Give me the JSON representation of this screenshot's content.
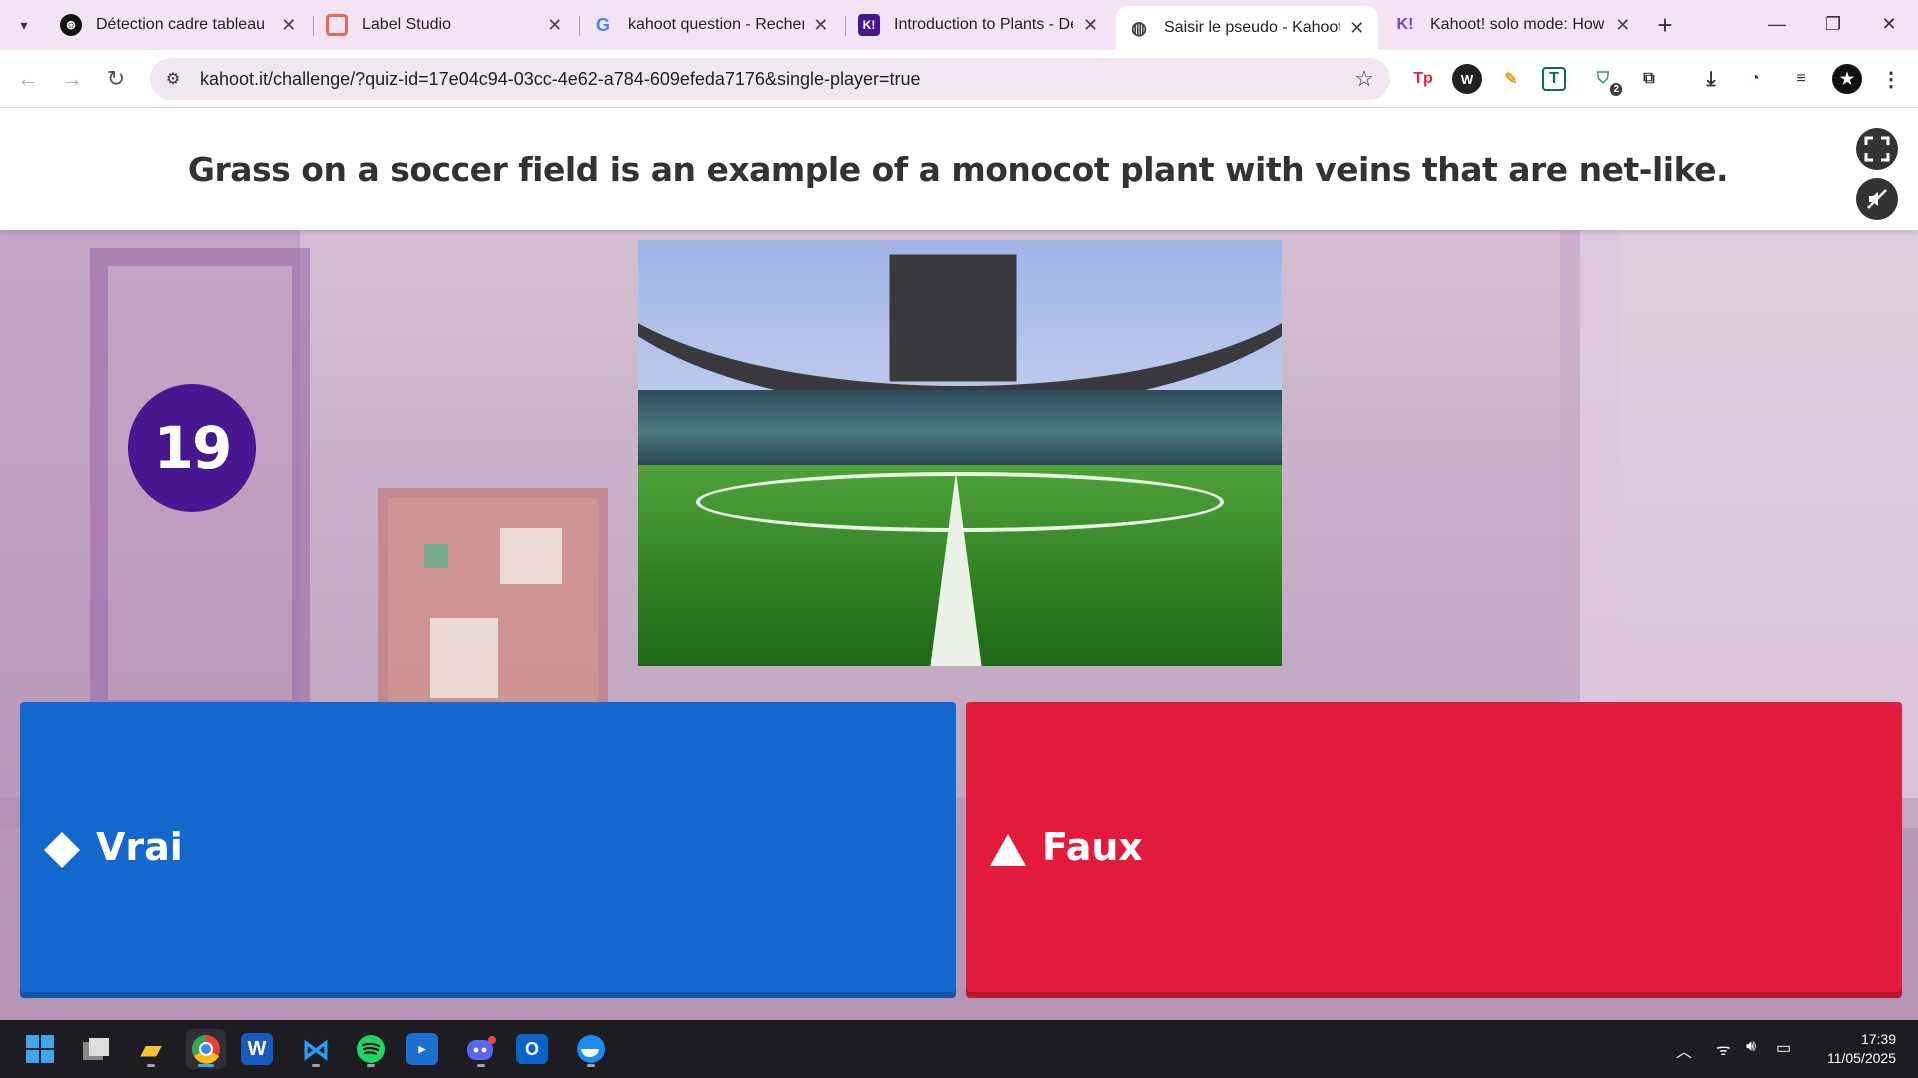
{
  "browser": {
    "tabs": [
      {
        "title": "Détection cadre tableau",
        "icon": "openai-icon",
        "active": false
      },
      {
        "title": "Label Studio",
        "icon": "label-studio-icon",
        "active": false
      },
      {
        "title": "kahoot question - Recherche",
        "icon": "google-icon",
        "active": false
      },
      {
        "title": "Introduction to Plants - Dé",
        "icon": "kahoot-icon",
        "active": false
      },
      {
        "title": "Saisir le pseudo - Kahoots",
        "icon": "globe-icon",
        "active": true
      },
      {
        "title": "Kahoot! solo mode: How to",
        "icon": "kahoot-icon",
        "active": false
      }
    ],
    "url": "kahoot.it/challenge/?quiz-id=17e04c94-03cc-4e62-a784-609efeda7176&single-player=true",
    "extension_badge": "2"
  },
  "quiz": {
    "question": "Grass on a soccer field is an example of a monocot plant with veins that are net-like.",
    "timer": "19",
    "answers": [
      {
        "label": "Vrai",
        "shape": "diamond",
        "color": "#1368ce"
      },
      {
        "label": "Faux",
        "shape": "triangle",
        "color": "#e21b3c"
      }
    ]
  },
  "taskbar": {
    "time": "17:39",
    "date": "11/05/2025"
  }
}
